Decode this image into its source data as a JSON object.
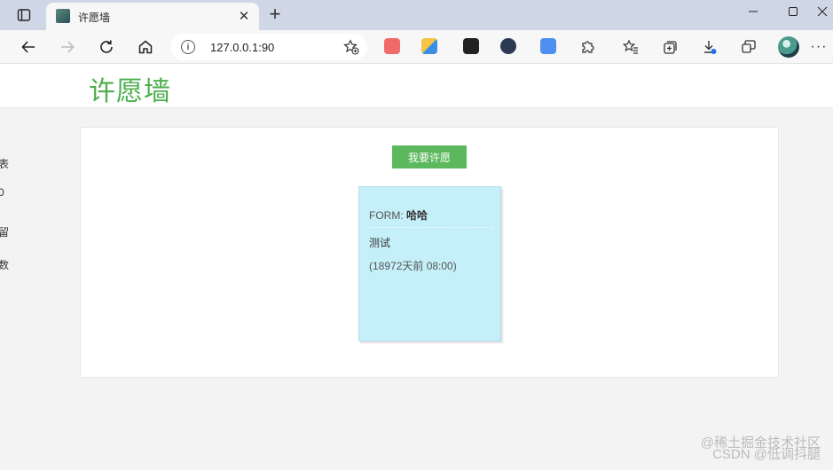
{
  "browser": {
    "tab": {
      "title": "许愿墙"
    },
    "address": {
      "url": "127.0.0.1:90"
    },
    "icons": {
      "tab_actions": "tab-actions-icon",
      "back": "back-arrow-icon",
      "forward": "forward-arrow-icon",
      "refresh": "refresh-icon",
      "home": "home-icon",
      "info": "info-icon",
      "add_favorite": "add-favorite-icon",
      "favorites": "favorites-icon",
      "collections": "collections-icon",
      "downloads": "downloads-icon",
      "screenshot": "screenshot-icon"
    }
  },
  "page": {
    "brand": "许愿墙",
    "make_wish_label": "我要许愿",
    "card": {
      "from_label": "FORM:",
      "from_name": "哈哈",
      "message": "测试",
      "time": "(18972天前 08:00)"
    },
    "watermark": {
      "line1": "@稀土掘金技术社区",
      "line2": "CSDN @低调抖腿"
    },
    "left_edge_glyphs": [
      "表",
      "0",
      "留",
      "数"
    ]
  },
  "colors": {
    "brand_green": "#4cae4c",
    "button_green": "#5cb85c",
    "card_blue": "#c5eff9"
  }
}
